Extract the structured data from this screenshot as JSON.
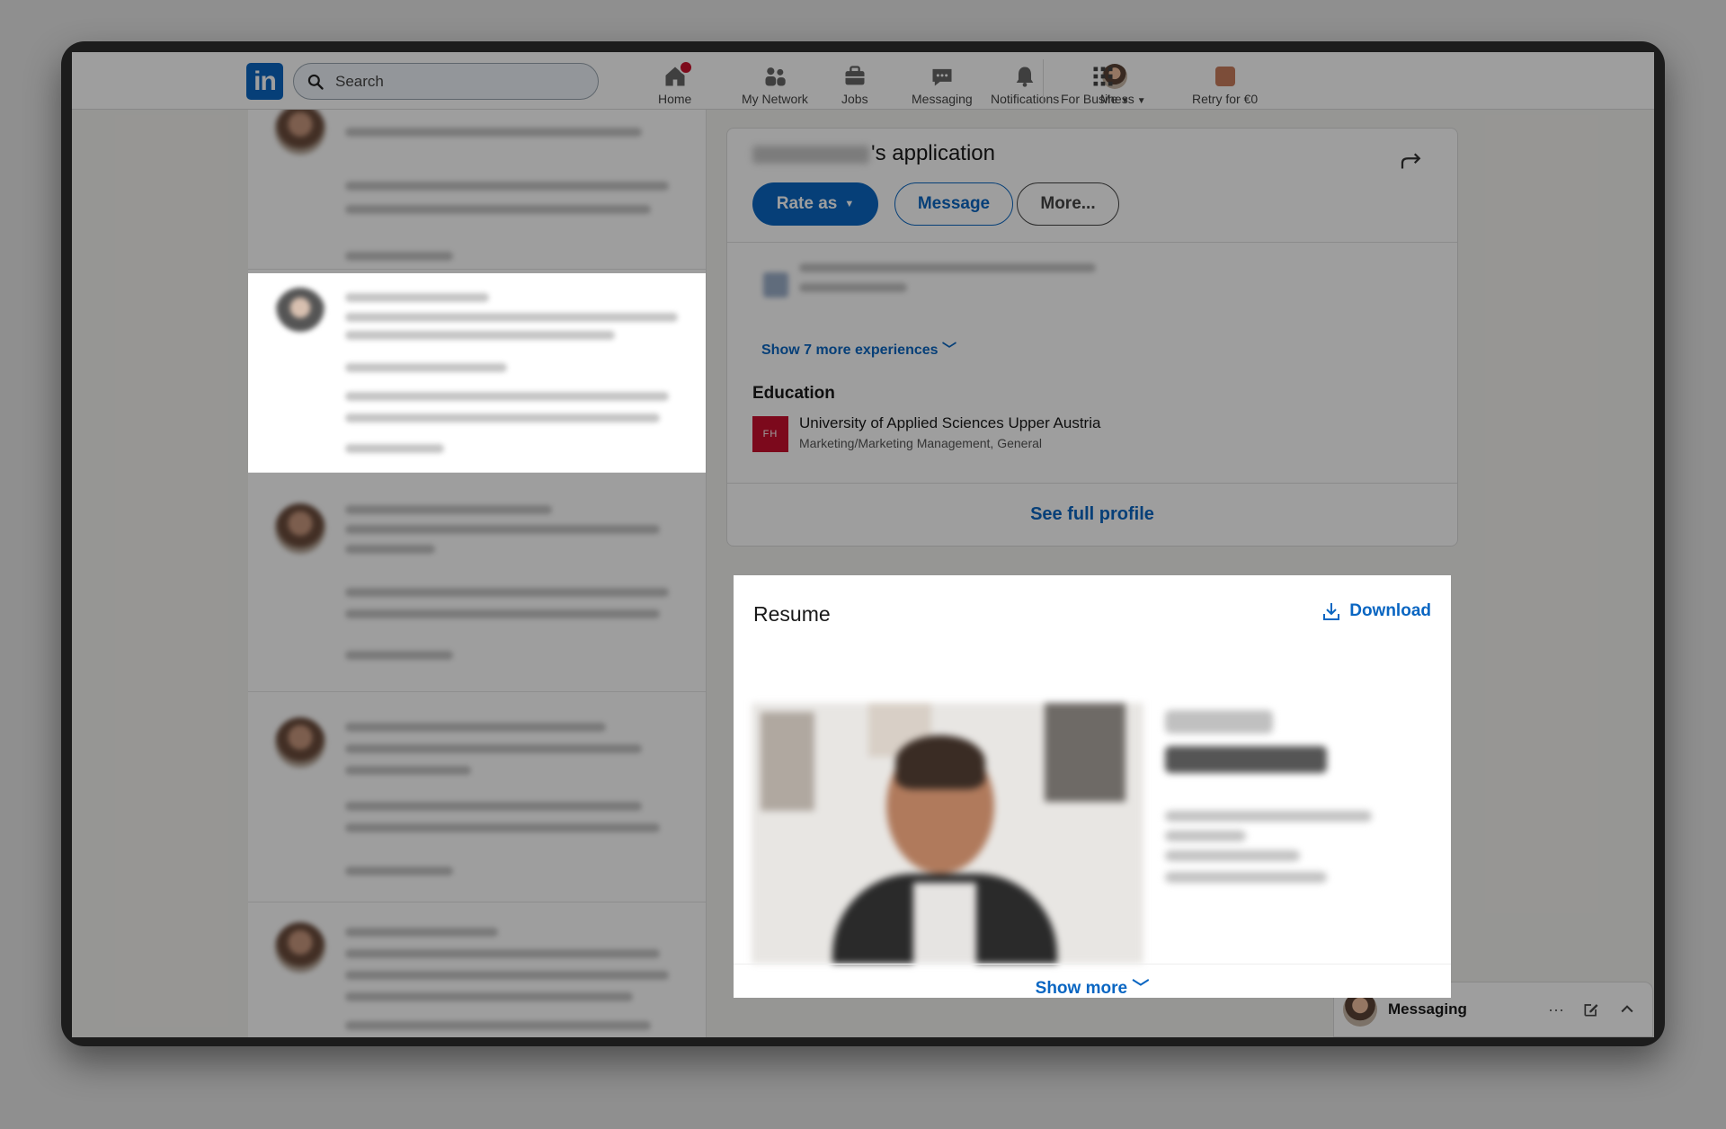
{
  "nav": {
    "logo": "in",
    "search_placeholder": "Search",
    "items": [
      {
        "label": "Home",
        "icon": "home-icon"
      },
      {
        "label": "My Network",
        "icon": "network-icon"
      },
      {
        "label": "Jobs",
        "icon": "jobs-icon"
      },
      {
        "label": "Messaging",
        "icon": "messaging-icon"
      },
      {
        "label": "Notifications",
        "icon": "bell-icon"
      },
      {
        "label": "Me",
        "icon": "avatar"
      },
      {
        "label": "For Business",
        "icon": "grid-icon"
      },
      {
        "label": "Retry for €0",
        "icon": "premium-icon"
      }
    ]
  },
  "application": {
    "title_suffix": "'s application",
    "rate_button": "Rate as",
    "message_button": "Message",
    "more_button": "More...",
    "show_experiences": "Show 7 more experiences",
    "education_heading": "Education",
    "school_logo": "FH",
    "school_name": "University of Applied Sciences Upper Austria",
    "degree": "Marketing/Marketing Management, General",
    "see_full_profile": "See full profile"
  },
  "resume": {
    "title": "Resume",
    "download": "Download",
    "show_more": "Show more"
  },
  "messaging": {
    "title": "Messaging",
    "more": "···"
  },
  "colors": {
    "brand": "#0a66c2",
    "notification_badge": "#cb112d",
    "school_logo": "#c8102e"
  }
}
